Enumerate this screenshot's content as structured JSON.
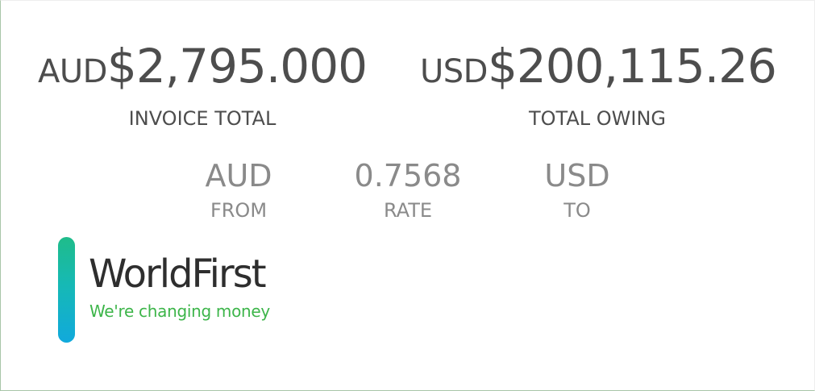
{
  "invoice": {
    "currency": "AUD",
    "amount": "$2,795.000",
    "label": "INVOICE TOTAL"
  },
  "owing": {
    "currency": "USD",
    "amount": "$200,115.26",
    "label": "TOTAL OWING"
  },
  "conversion": {
    "from_currency": "AUD",
    "from_label": "FROM",
    "rate_value": "0.7568",
    "rate_label": "RATE",
    "to_currency": "USD",
    "to_label": "TO"
  },
  "logo": {
    "name": "WorldFirst",
    "tagline": "We're changing money"
  },
  "colors": {
    "text_primary": "#4d4d4d",
    "text_secondary": "#8a8a8a",
    "brand_green": "#3db54a",
    "brand_teal": "#16b9b5",
    "brand_blue": "#11a9dc"
  }
}
